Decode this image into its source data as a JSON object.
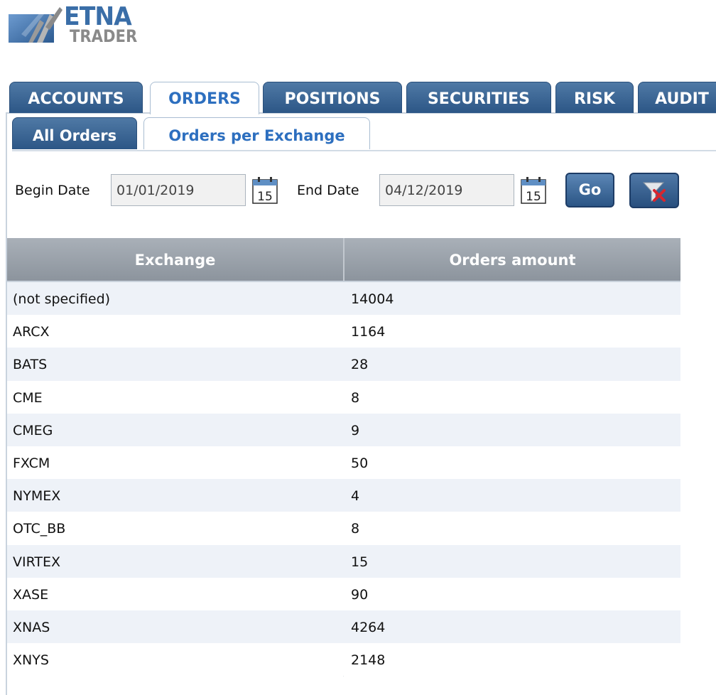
{
  "logo": {
    "line1": "ETNA",
    "line2": "TRADER"
  },
  "main_tabs": [
    {
      "label": "ACCOUNTS",
      "active": false
    },
    {
      "label": "ORDERS",
      "active": true
    },
    {
      "label": "POSITIONS",
      "active": false
    },
    {
      "label": "SECURITIES",
      "active": false
    },
    {
      "label": "RISK",
      "active": false
    },
    {
      "label": "AUDIT",
      "active": false
    }
  ],
  "sub_tabs": [
    {
      "label": "All Orders",
      "active": false
    },
    {
      "label": "Orders per Exchange",
      "active": true
    }
  ],
  "filters": {
    "begin_label": "Begin Date",
    "begin_value": "01/01/2019",
    "end_label": "End Date",
    "end_value": "04/12/2019",
    "calendar_day": "15",
    "go_label": "Go",
    "clear_icon": "clear-filter-icon"
  },
  "table": {
    "headers": [
      "Exchange",
      "Orders amount"
    ],
    "rows": [
      {
        "exchange": "(not specified)",
        "amount": "14004"
      },
      {
        "exchange": "ARCX",
        "amount": "1164"
      },
      {
        "exchange": "BATS",
        "amount": "28"
      },
      {
        "exchange": "CME",
        "amount": "8"
      },
      {
        "exchange": "CMEG",
        "amount": "9"
      },
      {
        "exchange": "FXCM",
        "amount": "50"
      },
      {
        "exchange": "NYMEX",
        "amount": "4"
      },
      {
        "exchange": "OTC_BB",
        "amount": "8"
      },
      {
        "exchange": "VIRTEX",
        "amount": "15"
      },
      {
        "exchange": "XASE",
        "amount": "90"
      },
      {
        "exchange": "XNAS",
        "amount": "4264"
      },
      {
        "exchange": "XNYS",
        "amount": "2148"
      }
    ]
  },
  "colors": {
    "tab_blue": "#2c5686",
    "active_tab_text": "#2d6fbf",
    "header_gray": "#9aa1a9",
    "row_alt": "#eef2f8"
  }
}
